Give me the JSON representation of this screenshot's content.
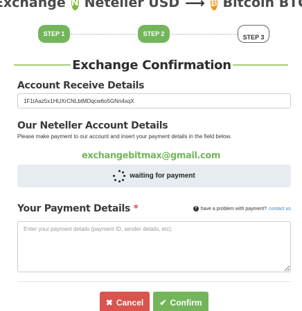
{
  "header": {
    "exchange_label": "Exchange",
    "from_currency": "Neteller USD",
    "arrow": "⟶",
    "to_currency": "Bitcoin BTC",
    "from_icon": "neteller-icon",
    "to_icon": "bitcoin-icon"
  },
  "steps": [
    {
      "label": "STEP 1",
      "state": "done"
    },
    {
      "label": "STEP 2",
      "state": "done"
    },
    {
      "label": "STEP 3",
      "state": "todo"
    }
  ],
  "section_title": "Exchange Confirmation",
  "account_receive": {
    "label": "Account Receive Details",
    "value": "1F1tAaz5x1HUXrCNLbtMDqcw6o5GNn4xqX"
  },
  "our_account": {
    "label": "Our Neteller Account Details",
    "note": "Please make payment to our account and insert your payment details in the field below.",
    "email": "exchangebitmax@gmail.com"
  },
  "status": {
    "text": "waiting for payment"
  },
  "payment_details": {
    "label": "Your Payment Details",
    "required_mark": "*",
    "help_text": "have a problem with payment?",
    "help_link": "contact us",
    "placeholder": "Enter your payment details (payment ID, sender details, etc)."
  },
  "buttons": {
    "cancel": "Cancel",
    "confirm": "Confirm"
  },
  "colors": {
    "green": "#74b55c",
    "red": "#d9534f",
    "link": "#3a83c3",
    "neteller": "#83ba3b",
    "bitcoin": "#f7931a"
  }
}
